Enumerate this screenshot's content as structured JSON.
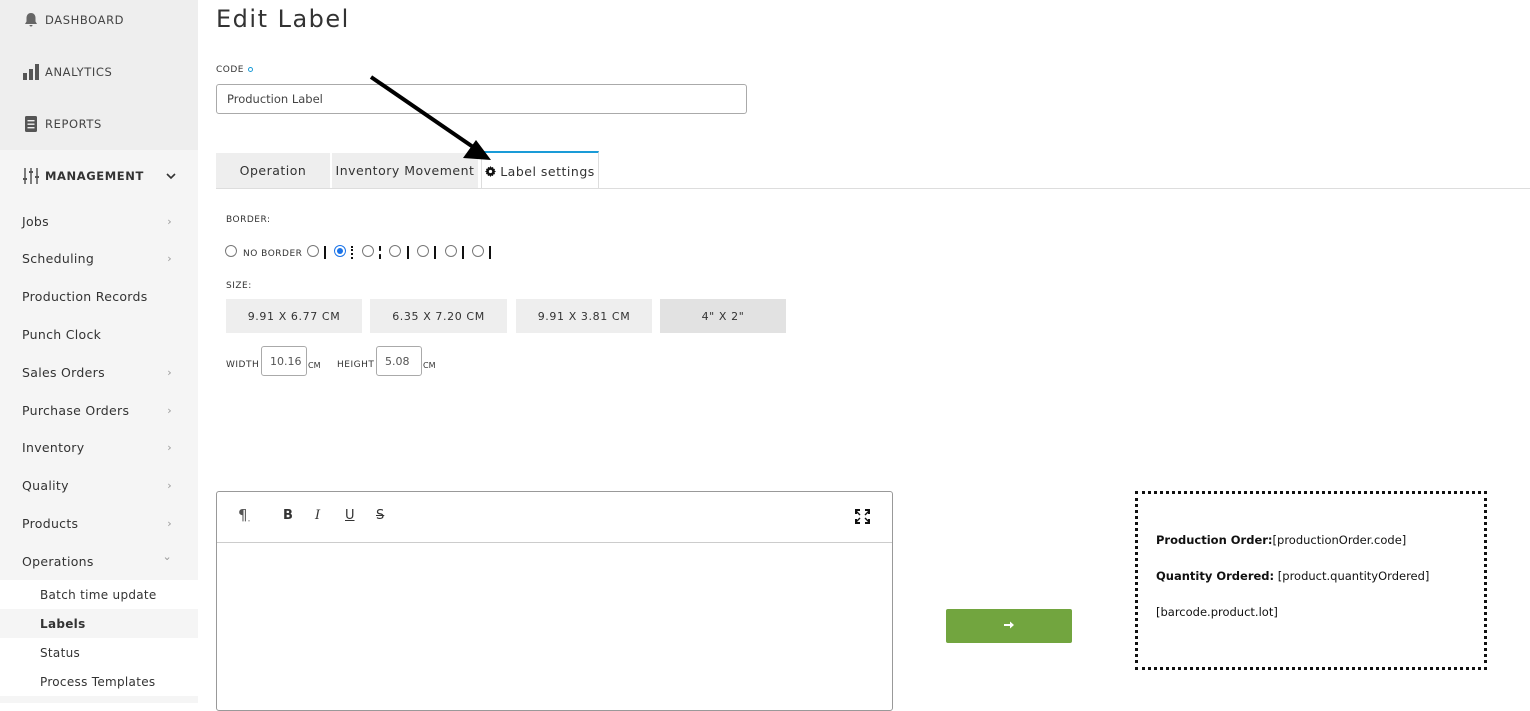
{
  "sidebar": {
    "top_items": [
      {
        "label": "DASHBOARD",
        "icon": "bell-icon"
      },
      {
        "label": "ANALYTICS",
        "icon": "bar-chart-icon"
      },
      {
        "label": "REPORTS",
        "icon": "document-icon"
      }
    ],
    "management": {
      "label": "MANAGEMENT",
      "icon": "sliders-icon"
    },
    "items": [
      {
        "label": "Jobs",
        "arrow": "›"
      },
      {
        "label": "Scheduling",
        "arrow": "›"
      },
      {
        "label": "Production Records",
        "arrow": ""
      },
      {
        "label": "Punch Clock",
        "arrow": ""
      },
      {
        "label": "Sales Orders",
        "arrow": "›"
      },
      {
        "label": "Purchase Orders",
        "arrow": "›"
      },
      {
        "label": "Inventory",
        "arrow": "›"
      },
      {
        "label": "Quality",
        "arrow": "›"
      },
      {
        "label": "Products",
        "arrow": "›"
      },
      {
        "label": "Operations",
        "arrow": "⌄"
      }
    ],
    "sub_items": [
      {
        "label": "Batch time update"
      },
      {
        "label": "Labels"
      },
      {
        "label": "Status"
      },
      {
        "label": "Process Templates"
      }
    ]
  },
  "page": {
    "title": "Edit Label",
    "code_label": "CODE",
    "code_value": "Production Label"
  },
  "tabs": [
    {
      "label": "Operation"
    },
    {
      "label": "Inventory Movement"
    },
    {
      "label": "Label settings",
      "icon": "gear-icon"
    }
  ],
  "settings": {
    "border_label": "BORDER:",
    "no_border_label": "NO BORDER",
    "size_label": "SIZE:",
    "sizes": [
      {
        "label": "9.91 X 6.77 CM"
      },
      {
        "label": "6.35 X 7.20 CM"
      },
      {
        "label": "9.91 X 3.81 CM"
      },
      {
        "label": "4\" X 2\""
      }
    ],
    "width_label": "WIDTH",
    "width_value": "10.16",
    "height_label": "HEIGHT",
    "height_value": "5.08",
    "unit": "CM"
  },
  "editor": {
    "toolbar": [
      {
        "glyph": "¶",
        "icon": "paragraph-icon"
      },
      {
        "glyph": "B",
        "icon": "bold-icon"
      },
      {
        "glyph": "I",
        "icon": "italic-icon"
      },
      {
        "glyph": "U",
        "icon": "underline-icon"
      },
      {
        "glyph": "S",
        "icon": "strikethrough-icon"
      }
    ],
    "fullscreen_icon": "expand-icon"
  },
  "preview": {
    "lines": [
      {
        "bold": "Production Order:",
        "text": "[productionOrder.code]"
      },
      {
        "bold": "Quantity Ordered:",
        "text": " [product.quantityOrdered]"
      },
      {
        "bold": "",
        "text": "[barcode.product.lot]"
      }
    ]
  },
  "colors": {
    "accent": "#1a9bd7",
    "go_button": "#72a53f"
  }
}
